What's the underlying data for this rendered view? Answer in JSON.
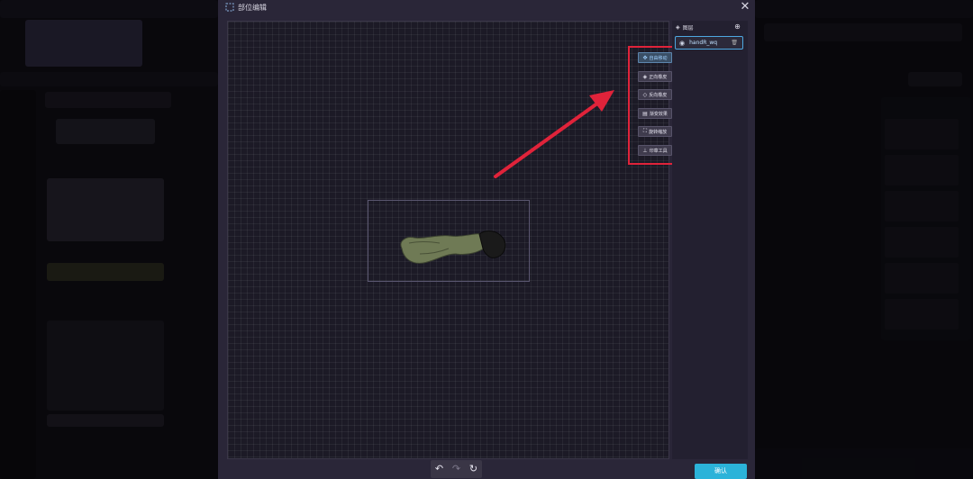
{
  "dialog": {
    "title": "部位编辑",
    "close_icon": "close-icon",
    "confirm_label": "确认"
  },
  "toolbox": {
    "tools": [
      {
        "label": "自由移动",
        "icon": "move-icon",
        "active": true
      },
      {
        "label": "正向橡皮",
        "icon": "eraser-icon",
        "active": false
      },
      {
        "label": "反向橡皮",
        "icon": "eraser-reverse-icon",
        "active": false
      },
      {
        "label": "渐变效果",
        "icon": "gradient-icon",
        "active": false
      },
      {
        "label": "旋转缩放",
        "icon": "transform-icon",
        "active": false
      },
      {
        "label": "印章工具",
        "icon": "stamp-icon",
        "active": false
      }
    ]
  },
  "layers": {
    "title": "图层",
    "items": [
      {
        "name": "handR_wq"
      }
    ]
  },
  "history": {
    "undo_icon": "undo-icon",
    "redo_icon": "redo-icon",
    "reset_icon": "reset-icon"
  },
  "colors": {
    "accent": "#2bb3d9",
    "highlight": "#e0233a",
    "dialog_bg": "#2a2638",
    "canvas_bg": "#1c1a26"
  }
}
